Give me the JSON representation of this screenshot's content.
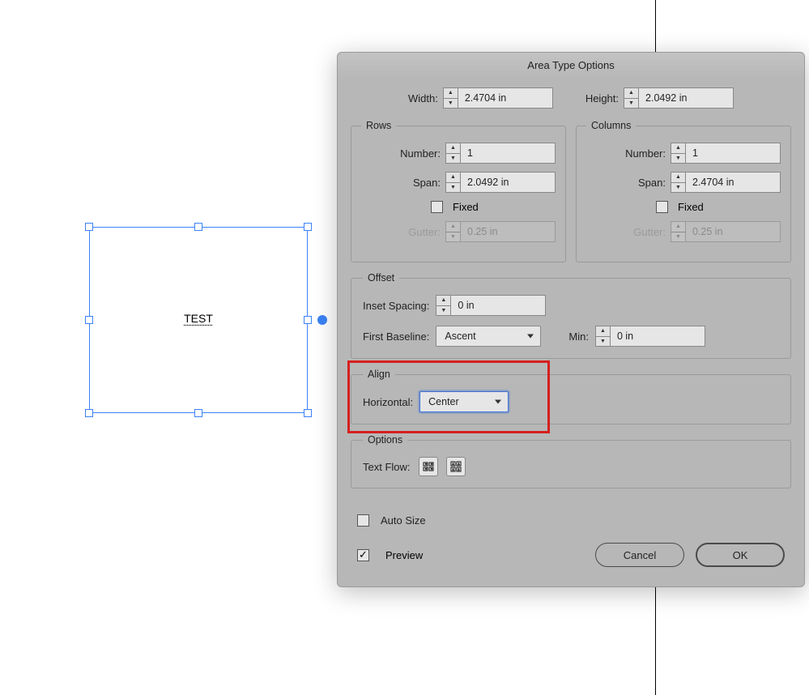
{
  "canvas": {
    "text": "TEST"
  },
  "dialog": {
    "title": "Area Type Options",
    "width_label": "Width:",
    "width_value": "2.4704 in",
    "height_label": "Height:",
    "height_value": "2.0492 in",
    "rows": {
      "legend": "Rows",
      "number_label": "Number:",
      "number_value": "1",
      "span_label": "Span:",
      "span_value": "2.0492 in",
      "fixed_label": "Fixed",
      "gutter_label": "Gutter:",
      "gutter_value": "0.25 in"
    },
    "columns": {
      "legend": "Columns",
      "number_label": "Number:",
      "number_value": "1",
      "span_label": "Span:",
      "span_value": "2.4704 in",
      "fixed_label": "Fixed",
      "gutter_label": "Gutter:",
      "gutter_value": "0.25 in"
    },
    "offset": {
      "legend": "Offset",
      "inset_label": "Inset Spacing:",
      "inset_value": "0 in",
      "baseline_label": "First Baseline:",
      "baseline_value": "Ascent",
      "min_label": "Min:",
      "min_value": "0 in"
    },
    "align": {
      "legend": "Align",
      "horizontal_label": "Horizontal:",
      "horizontal_value": "Center"
    },
    "options": {
      "legend": "Options",
      "textflow_label": "Text Flow:"
    },
    "autosize_label": "Auto Size",
    "preview_label": "Preview",
    "cancel": "Cancel",
    "ok": "OK"
  }
}
